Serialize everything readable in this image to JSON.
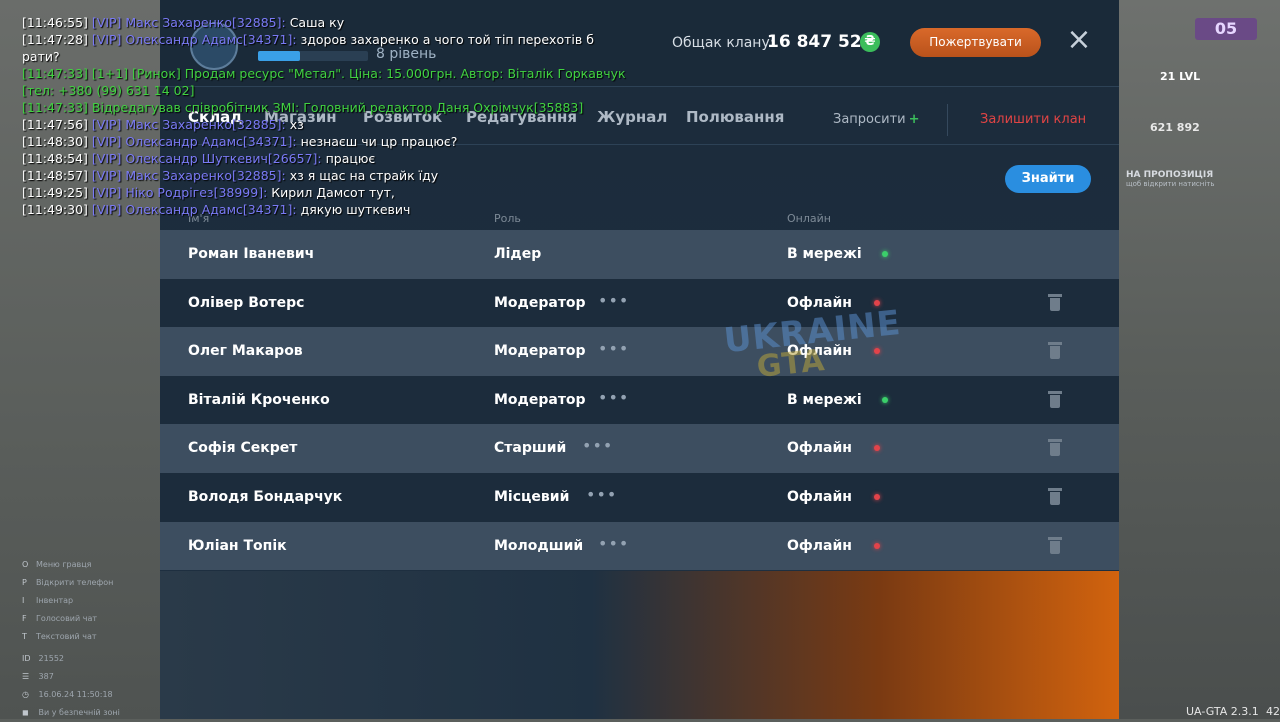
{
  "panel": {
    "clan_level": "8 рівень",
    "fund_label": "Общак клану:",
    "fund_value": "16 847 525",
    "fund_icon": "₴",
    "donate_label": "Пожертвувати",
    "close_icon": "×"
  },
  "tabs": {
    "t1": "Склад",
    "t2": "Магазин",
    "t3": "Розвиток",
    "t4": "Редагування",
    "t5": "Журнал",
    "t6": "Полювання",
    "invite": "Запросити",
    "leave": "Залишити клан"
  },
  "find_label": "Знайти",
  "columns": {
    "name": "Ім'я",
    "role": "Роль",
    "online": "Онлайн"
  },
  "members": [
    {
      "name": "Роман Іваневич",
      "role": "Лідер",
      "status": "В мережі"
    },
    {
      "name": "Олівер Вотерс",
      "role": "Модератор",
      "status": "Офлайн"
    },
    {
      "name": "Олег Макаров",
      "role": "Модератор",
      "status": "Офлайн"
    },
    {
      "name": "Віталій Кроченко",
      "role": "Модератор",
      "status": "В мережі"
    },
    {
      "name": "Софія Секрет",
      "role": "Старший",
      "status": "Офлайн"
    },
    {
      "name": "Володя Бондарчук",
      "role": "Місцевий",
      "status": "Офлайн"
    },
    {
      "name": "Юліан Топік",
      "role": "Молодший",
      "status": "Офлайн"
    }
  ],
  "more_icon": "•••",
  "watermark": {
    "line1": "UKRAINE",
    "line2": "GTA"
  },
  "chat": [
    {
      "time": "[11:46:55]",
      "tag": "[VIP] Макс Захаренко[32885]:",
      "msg": "Саша ку"
    },
    {
      "time": "[11:47:28]",
      "tag": "[VIP] Олександр Адамс[34371]:",
      "msg": "здоров захаренко а чого той тіп перехотів б"
    },
    {
      "cont": "рати?"
    },
    {
      "green": "[11:47:33] [1+1] [Ринок] Продам ресурс \"Метал\". Ціна: 15.000грн. Автор: Віталік Горкавчук"
    },
    {
      "green": " [тел: +380 (99) 631 14 02]"
    },
    {
      "green": "[11:47:33]  Відредагував співробітник ЗМІ: Головний редактор Даня Охрімчук[35883]"
    },
    {
      "time": "[11:47:56]",
      "tag": "[VIP] Макс Захаренко[32885]:",
      "msg": "хз"
    },
    {
      "time": "[11:48:30]",
      "tag": "[VIP] Олександр Адамс[34371]:",
      "msg": "незнаєш чи цр працює?"
    },
    {
      "time": "[11:48:54]",
      "tag": "[VIP] Олександр Шуткевич[26657]:",
      "msg": "працює"
    },
    {
      "time": "[11:48:57]",
      "tag": "[VIP] Макс Захаренко[32885]:",
      "msg": "хз я щас на страйк їду"
    },
    {
      "time": "[11:49:25]",
      "tag": "[VIP] Ніко Родрігез[38999]:",
      "msg": "Кирил Дамсот тут,"
    },
    {
      "time": "[11:49:30]",
      "tag": "[VIP] Олександр Адамс[34371]:",
      "msg": "дякую шуткевич"
    }
  ],
  "hints": [
    {
      "key": "O",
      "label": "Меню гравця"
    },
    {
      "key": "P",
      "label": "Відкрити телефон"
    },
    {
      "key": "I",
      "label": "Інвентар"
    },
    {
      "key": "F",
      "label": "Голосовий чат"
    },
    {
      "key": "T",
      "label": "Текстовий чат"
    }
  ],
  "stats": {
    "id": "21552",
    "online": "387",
    "datetime": "16.06.24 11:50:18",
    "zone": "Ви у безпечній зоні"
  },
  "hud": {
    "badge": "05",
    "level": "21 LVL",
    "money": "621 892",
    "offer_title": "НА ПРОПОЗИЦІЯ",
    "offer_sub": "щоб відкрити натисніть"
  },
  "version": "UA-GTA 2.3.1",
  "fps": "42"
}
